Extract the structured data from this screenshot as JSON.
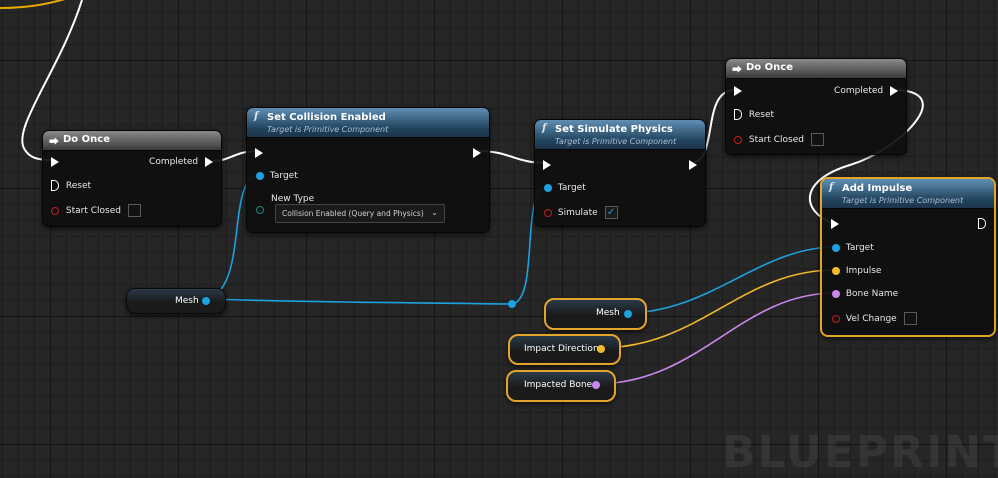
{
  "watermark": "BLUEPRINT",
  "nodes": {
    "do_once_1": {
      "title": "Do Once",
      "completed_label": "Completed",
      "reset_label": "Reset",
      "start_closed_label": "Start Closed",
      "start_closed_checked": false
    },
    "set_collision": {
      "title": "Set Collision Enabled",
      "subtitle": "Target is Primitive Component",
      "target_label": "Target",
      "new_type_label": "New Type",
      "new_type_value": "Collision Enabled (Query and Physics)"
    },
    "set_simulate": {
      "title": "Set Simulate Physics",
      "subtitle": "Target is Primitive Component",
      "target_label": "Target",
      "simulate_label": "Simulate",
      "simulate_checked": true
    },
    "do_once_2": {
      "title": "Do Once",
      "completed_label": "Completed",
      "reset_label": "Reset",
      "start_closed_label": "Start Closed",
      "start_closed_checked": false
    },
    "add_impulse": {
      "title": "Add Impulse",
      "subtitle": "Target is Primitive Component",
      "target_label": "Target",
      "impulse_label": "Impulse",
      "bone_name_label": "Bone Name",
      "vel_change_label": "Vel Change",
      "vel_change_checked": false
    }
  },
  "variables": {
    "mesh_1": "Mesh",
    "mesh_2": "Mesh",
    "impact_direction": "Impact Direction",
    "impacted_bone": "Impacted Bone"
  },
  "colors": {
    "exec_wire": "#ffffff",
    "object_pin": "#1da1e0",
    "vector_pin": "#f1b92b",
    "name_pin": "#c887ea",
    "bool_pin": "#c32020",
    "byte_pin": "#1a8a7e",
    "selection": "#e3a42a"
  },
  "icons": {
    "function": "function-f-icon",
    "do_once": "do-once-icon",
    "dropdown": "chevron-down-icon",
    "check": "checkmark-icon"
  }
}
